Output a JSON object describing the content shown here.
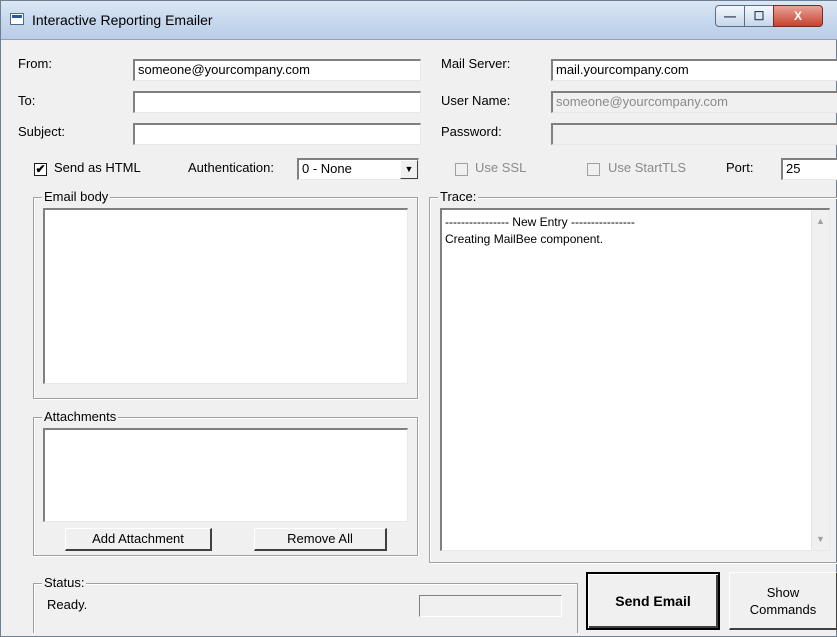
{
  "window": {
    "title": "Interactive Reporting Emailer",
    "minimize": "—",
    "maximize": "☐",
    "close": "X"
  },
  "form": {
    "from_label": "From:",
    "from_value": "someone@yourcompany.com",
    "to_label": "To:",
    "to_value": "",
    "subject_label": "Subject:",
    "subject_value": "",
    "mail_server_label": "Mail Server:",
    "mail_server_value": "mail.yourcompany.com",
    "user_name_label": "User Name:",
    "user_name_value": "someone@yourcompany.com",
    "password_label": "Password:",
    "password_value": ""
  },
  "options": {
    "send_as_html_label": "Send as HTML",
    "send_as_html_checked": "✔",
    "authentication_label": "Authentication:",
    "authentication_value": "0 - None",
    "dropdown_arrow": "▼",
    "use_ssl_label": "Use SSL",
    "use_starttls_label": "Use StartTLS",
    "port_label": "Port:",
    "port_value": "25"
  },
  "email_body": {
    "legend": "Email body",
    "content": ""
  },
  "attachments": {
    "legend": "Attachments",
    "add_label": "Add Attachment",
    "remove_label": "Remove All"
  },
  "trace": {
    "legend": "Trace:",
    "line1": "---------------- New Entry ----------------",
    "line2": "Creating MailBee component.",
    "scroll_up": "▲",
    "scroll_down": "▼"
  },
  "status": {
    "legend": "Status:",
    "text": "Ready.",
    "progress": 0
  },
  "buttons": {
    "send_email": "Send Email",
    "show_commands_line1": "Show",
    "show_commands_line2": "Commands"
  }
}
